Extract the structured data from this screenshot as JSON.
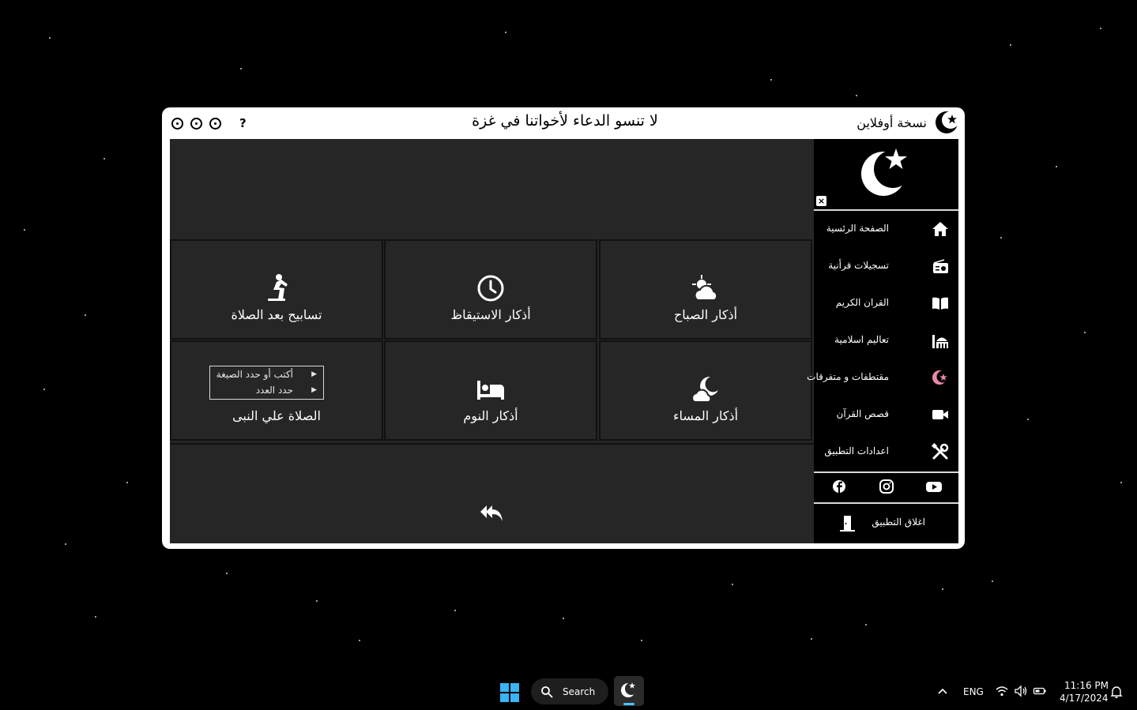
{
  "titlebar": {
    "app_name": "نسخة أوفلاين",
    "banner": "لا تنسو الدعاء لأخواتنا في غزة",
    "help": "?"
  },
  "tiles": [
    {
      "label": "أذكار الصباح",
      "icon": "sun-cloud-icon"
    },
    {
      "label": "أذكار الاستيقاظ",
      "icon": "clock-icon"
    },
    {
      "label": "تسابيح بعد الصلاة",
      "icon": "praying-person-icon"
    },
    {
      "label": "أذكار المساء",
      "icon": "moon-cloud-icon"
    },
    {
      "label": "أذكار النوم",
      "icon": "bed-icon"
    },
    {
      "label": "الصلاة علي النبى",
      "icon": "none"
    }
  ],
  "context_menu": [
    {
      "label": "أكتب أو حدد الصيغة"
    },
    {
      "label": "حدد العدد"
    }
  ],
  "sidebar": {
    "close": "×",
    "items": [
      {
        "label": "الصفحة الرئسية",
        "icon": "home-icon"
      },
      {
        "label": "تسجيلات قرأنية",
        "icon": "radio-icon"
      },
      {
        "label": "القران الكريم",
        "icon": "book-icon"
      },
      {
        "label": "تعاليم اسلامية",
        "icon": "mosque-icon"
      },
      {
        "label": "مقتطفات و متفرقات",
        "icon": "crescent-star-icon"
      },
      {
        "label": "قصص القرآن",
        "icon": "video-icon"
      },
      {
        "label": "اعدادات التطبيق",
        "icon": "tools-icon"
      }
    ],
    "social": [
      "facebook-icon",
      "instagram-icon",
      "youtube-icon"
    ],
    "exit_label": "اغلاق التطبيق"
  },
  "taskbar": {
    "search_label": "Search",
    "language": "ENG",
    "time": "11:16 PM",
    "date": "4/17/2024"
  },
  "colors": {
    "panel": "#262626",
    "sidebar": "#000000",
    "accent_pink": "#e88aa8",
    "taskbar_accent": "#4cc2ff"
  }
}
